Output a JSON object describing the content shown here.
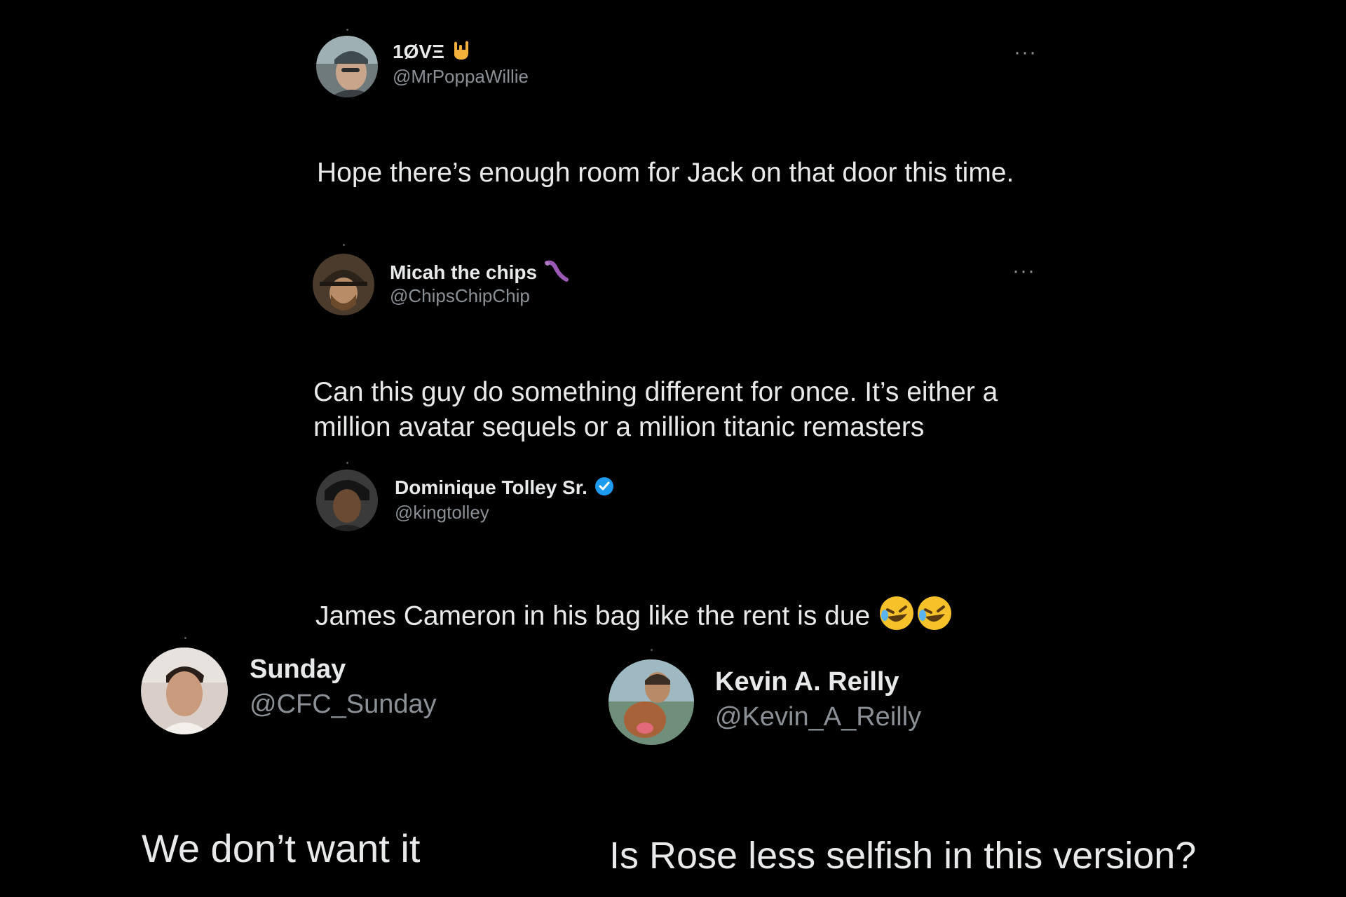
{
  "colors": {
    "background": "#000000",
    "text_primary": "#e7e9ea",
    "text_secondary": "#8b9096",
    "verified": "#1d9bf0",
    "emoji_face": "#f7c12a"
  },
  "tweets": [
    {
      "display_name": "1ØVΞ",
      "name_icon": "rock-hand-emoji",
      "handle": "@MrPoppaWillie",
      "text": "Hope there’s enough room for Jack on that door this time.",
      "more_label": "···"
    },
    {
      "display_name": "Micah the chips",
      "name_icon": "worm-emoji",
      "handle": "@ChipsChipChip",
      "text": "Can this guy do something different for once. It’s either a million avatar sequels or a million titanic remasters",
      "more_label": "···"
    },
    {
      "display_name": "Dominique Tolley Sr.",
      "name_icon": "verified-badge-icon",
      "handle": "@kingtolley",
      "text": "James Cameron in his bag like the rent is due",
      "text_icons": [
        "rolling-laughing-emoji",
        "rolling-laughing-emoji"
      ]
    },
    {
      "display_name": "Sunday",
      "handle": "@CFC_Sunday",
      "text": "We don’t want it"
    },
    {
      "display_name": "Kevin A. Reilly",
      "handle": "@Kevin_A_Reilly",
      "text": "Is Rose less selfish in this version?"
    }
  ]
}
